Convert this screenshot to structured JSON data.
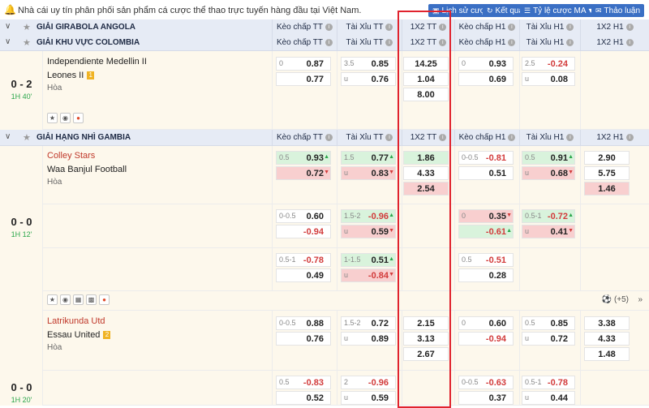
{
  "topbar": {
    "notice": "Nhà cái uy tín phân phối sản phẩm cá cược thể thao trực tuyến hàng đầu tại Việt Nam.",
    "btn_history": "Lịch sử cược",
    "btn_results": "Kết quả",
    "btn_odds": "Tỷ lệ cược MA",
    "btn_discuss": "Thảo luận"
  },
  "columns": {
    "handicap_ft": "Kèo chấp TT",
    "ou_ft": "Tài Xỉu TT",
    "x12_ft": "1X2 TT",
    "handicap_h1": "Kèo chấp H1",
    "ou_h1": "Tài Xỉu H1",
    "x12_h1": "1X2 H1"
  },
  "leagues": {
    "l1": "GIẢI GIRABOLA ANGOLA",
    "l2": "GIẢI KHU VỰC COLOMBIA",
    "l3": "GIẢI HẠNG NHÌ GAMBIA"
  },
  "m1": {
    "score": "0 - 2",
    "time": "1H 40'",
    "home": "Independiente Medellin II",
    "away": "Leones II",
    "away_badge": "1",
    "draw": "Hòa",
    "hdp": [
      [
        "0",
        "0.87"
      ],
      [
        "",
        "0.77"
      ]
    ],
    "ou": [
      [
        "3.5",
        "0.85"
      ],
      [
        "u",
        "0.76"
      ]
    ],
    "x12": [
      "14.25",
      "1.04",
      "8.00"
    ],
    "hdp1": [
      [
        "0",
        "0.93"
      ],
      [
        "",
        "0.69"
      ]
    ],
    "ou1": [
      [
        "2.5",
        "-0.24"
      ],
      [
        "u",
        "0.08"
      ]
    ]
  },
  "m2": {
    "score": "0 - 0",
    "time": "1H 12'",
    "home": "Colley Stars",
    "away": "Waa Banjul Football",
    "draw": "Hòa",
    "r1": {
      "hdp": [
        [
          "0.5",
          "0.93"
        ],
        [
          "",
          "0.72"
        ]
      ],
      "ou": [
        [
          "1.5",
          "0.77"
        ],
        [
          "u",
          "0.83"
        ]
      ],
      "x12": [
        "1.86",
        "4.33",
        "2.54"
      ],
      "hdp1": [
        [
          "0-0.5",
          "-0.81"
        ],
        [
          "",
          "0.51"
        ]
      ],
      "ou1": [
        [
          "0.5",
          "0.91"
        ],
        [
          "u",
          "0.68"
        ]
      ],
      "x121": [
        "2.90",
        "5.75",
        "1.46"
      ]
    },
    "r2": {
      "hdp": [
        [
          "0-0.5",
          "0.60"
        ],
        [
          "",
          "-0.94"
        ]
      ],
      "ou": [
        [
          "1.5-2",
          "-0.96"
        ],
        [
          "u",
          "0.59"
        ]
      ],
      "hdp1": [
        [
          "0",
          "0.35"
        ],
        [
          "",
          "-0.61"
        ]
      ],
      "ou1": [
        [
          "0.5-1",
          "-0.72"
        ],
        [
          "u",
          "0.41"
        ]
      ]
    },
    "r3": {
      "hdp": [
        [
          "0.5-1",
          "-0.78"
        ],
        [
          "",
          "0.49"
        ]
      ],
      "ou": [
        [
          "1-1.5",
          "0.51"
        ],
        [
          "u",
          "-0.84"
        ]
      ],
      "hdp1": [
        [
          "0.5",
          "-0.51"
        ],
        [
          "",
          "0.28"
        ]
      ]
    },
    "more": "(+5)"
  },
  "m3": {
    "score": "0 - 0",
    "time": "1H 20'",
    "home": "Latrikunda Utd",
    "away": "Essau United",
    "away_badge": "2",
    "draw": "Hòa",
    "r1": {
      "hdp": [
        [
          "0-0.5",
          "0.88"
        ],
        [
          "",
          "0.76"
        ]
      ],
      "ou": [
        [
          "1.5-2",
          "0.72"
        ],
        [
          "u",
          "0.89"
        ]
      ],
      "x12": [
        "2.15",
        "3.13",
        "2.67"
      ],
      "hdp1": [
        [
          "0",
          "0.60"
        ],
        [
          "",
          "-0.94"
        ]
      ],
      "ou1": [
        [
          "0.5",
          "0.85"
        ],
        [
          "u",
          "0.72"
        ]
      ],
      "x121": [
        "3.38",
        "4.33",
        "1.48"
      ]
    },
    "r2": {
      "hdp": [
        [
          "0.5",
          "-0.83"
        ],
        [
          "",
          "0.52"
        ]
      ],
      "ou": [
        [
          "2",
          "-0.96"
        ],
        [
          "u",
          "0.59"
        ]
      ],
      "hdp1": [
        [
          "0-0.5",
          "-0.63"
        ],
        [
          "",
          "0.37"
        ]
      ],
      "ou1": [
        [
          "0.5-1",
          "-0.78"
        ],
        [
          "u",
          "0.44"
        ]
      ]
    }
  }
}
